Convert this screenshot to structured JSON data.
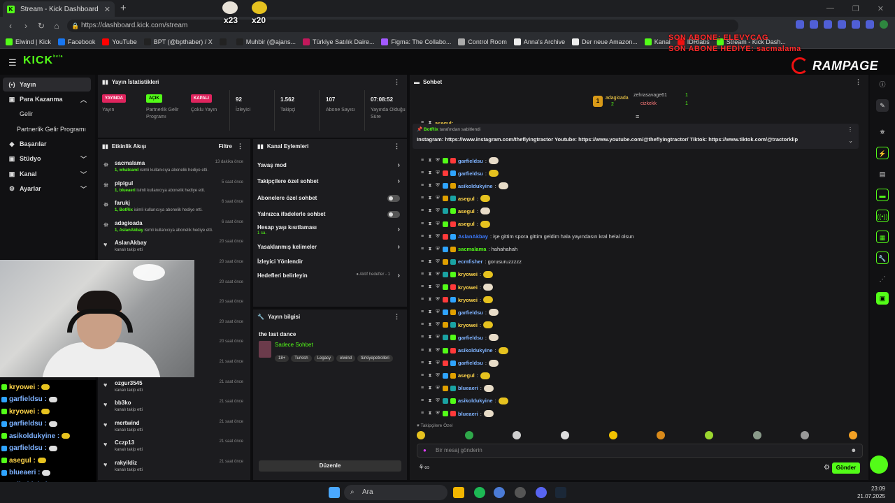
{
  "browser": {
    "tab_title": "Stream - Kick Dashboard",
    "url": "https://dashboard.kick.com/stream",
    "bookmarks": [
      "Elwind | Kick",
      "Facebook",
      "YouTube",
      "BPT (@bpthaber) / X",
      "",
      "Muhbir (@ajans...",
      "Türkiye Satılık Daire...",
      "Figma: The Collabo...",
      "Control Room",
      "Anna's Archive",
      "Der neue Amazon...",
      "Kanal",
      "IDRlabs",
      "Stream - Kick Dash..."
    ]
  },
  "overlay": {
    "last_follower": "SON ABONE: ELEVYCAG",
    "last_gift": "SON ABONE HEDİYE: sacmalama",
    "counter1": "x23",
    "counter2": "x20",
    "brand": "RAMPAGE"
  },
  "sidebar": {
    "items": [
      {
        "icon": "(•)",
        "label": "Yayın"
      },
      {
        "icon": "▣",
        "label": "Para Kazanma"
      },
      {
        "label": "Gelir"
      },
      {
        "label": "Partnerlik Gelir Programı"
      },
      {
        "icon": "◆",
        "label": "Başarılar"
      },
      {
        "icon": "▣",
        "label": "Stüdyo"
      },
      {
        "icon": "▣",
        "label": "Kanal"
      },
      {
        "icon": "⚙",
        "label": "Ayarlar"
      }
    ]
  },
  "stats": {
    "title": "Yayın İstatistikleri",
    "badges": [
      {
        "badge": "YAYINDA",
        "label": "Yayın"
      },
      {
        "badge": "AÇIK",
        "label": "Partnerlik Gelir Programı"
      },
      {
        "badge": "KAPALI",
        "label": "Çoklu Yayın"
      }
    ],
    "numbers": [
      {
        "value": "92",
        "label": "İzleyici"
      },
      {
        "value": "1.562",
        "label": "Takipçi"
      },
      {
        "value": "107",
        "label": "Abone Sayısı"
      },
      {
        "value": "07:08:52",
        "label": "Yayında Olduğu Süre"
      }
    ]
  },
  "activity": {
    "title": "Etkinlik Akışı",
    "filter": "Filtre",
    "items": [
      {
        "name": "sacmalama",
        "time": "13 dakika önce",
        "by": "1, whatcand",
        "rest": " isimli kullanıcıya abonelik hediye etti."
      },
      {
        "name": "pipigul",
        "time": "5 saat önce",
        "by": "1, blueaeri",
        "rest": " isimli kullanıcıya abonelik hediye etti."
      },
      {
        "name": "farukj",
        "time": "6 saat önce",
        "by": "1, BotRix",
        "rest": " isimli kullanıcıya abonelik hediye etti."
      },
      {
        "name": "adagioada",
        "time": "6 saat önce",
        "by": "1, AslanAkbay",
        "rest": " isimli kullanıcıya abonelik hediye etti."
      },
      {
        "name": "AslanAkbay",
        "time": "20 saat önce",
        "by": "",
        "rest": "kanalı takip etti"
      },
      {
        "name": "",
        "time": "20 saat önce",
        "by": "",
        "rest": ""
      },
      {
        "name": "",
        "time": "20 saat önce",
        "by": "",
        "rest": ""
      },
      {
        "name": "",
        "time": "20 saat önce",
        "by": "",
        "rest": ""
      },
      {
        "name": "",
        "time": "20 saat önce",
        "by": "",
        "rest": ""
      },
      {
        "name": "",
        "time": "20 saat önce",
        "by": "",
        "rest": ""
      },
      {
        "name": "",
        "time": "21 saat önce",
        "by": "",
        "rest": ""
      },
      {
        "name": "ozgur3545",
        "time": "21 saat önce",
        "by": "",
        "rest": "kanalı takip etti"
      },
      {
        "name": "bb3ko",
        "time": "21 saat önce",
        "by": "",
        "rest": "kanalı takip etti"
      },
      {
        "name": "mertwind",
        "time": "21 saat önce",
        "by": "",
        "rest": "kanalı takip etti"
      },
      {
        "name": "Cczp13",
        "time": "21 saat önce",
        "by": "",
        "rest": "kanalı takip etti"
      },
      {
        "name": "rakyildiz",
        "time": "21 saat önce",
        "by": "",
        "rest": "kanalı takip etti"
      }
    ]
  },
  "channel_actions": {
    "title": "Kanal Eylemleri",
    "items": [
      {
        "label": "Yavaş mod",
        "ctrl": "chev"
      },
      {
        "label": "Takipçilere özel sohbet",
        "ctrl": "chev"
      },
      {
        "label": "Abonelere özel sohbet",
        "ctrl": "toggle"
      },
      {
        "label": "Yalnızca ifadelerle sohbet",
        "ctrl": "toggle"
      },
      {
        "label": "Hesap yaşı kısıtlaması",
        "sub": "1 sa.",
        "ctrl": "chev"
      },
      {
        "label": "Yasaklanmış kelimeler",
        "ctrl": "chev"
      },
      {
        "label": "İzleyici Yönlendir",
        "ctrl": ""
      },
      {
        "label": "Hedefleri belirleyin",
        "extra": "● Aktif hedefler - 1",
        "ctrl": "chev"
      }
    ]
  },
  "stream_info": {
    "title": "Yayın bilgisi",
    "stream_title": "the last dance",
    "category": "Sadece Sohbet",
    "tags": [
      "18+",
      "Turkish",
      "Legacy",
      "elwind",
      "türkiyepetrolleri"
    ],
    "edit": "Düzenle"
  },
  "chat": {
    "title": "Sohbet",
    "gifters": [
      {
        "rank": "1",
        "name": "adagioada",
        "count": "2"
      },
      {
        "name": "zehrasavage61",
        "count": "1"
      },
      {
        "name": "cizkekk",
        "count": "1"
      }
    ],
    "pinned_by": "BotRix",
    "pinned_by_suffix": " tarafından sabitlendi",
    "pinned_text": "Instagram: https://www.instagram.com/theflyingtractor Youtube: https://www.youtube.com/@theflyingtractor/ Tiktok: https://www.tiktok.com/@tractorklip",
    "top_partial": "asegul:",
    "messages": [
      {
        "user": "garfieldsu",
        "color": "#7fb3ff",
        "text": ""
      },
      {
        "user": "garfieldsu",
        "color": "#7fb3ff",
        "text": ""
      },
      {
        "user": "asikoldukyine",
        "color": "#7fb3ff",
        "text": ""
      },
      {
        "user": "asegul",
        "color": "#ffd54a",
        "text": ""
      },
      {
        "user": "asegul",
        "color": "#ffd54a",
        "text": ""
      },
      {
        "user": "asegul",
        "color": "#ffd54a",
        "text": ""
      },
      {
        "user": "AslanAkbay",
        "color": "#3d7bff",
        "text": ": işe gittim spora gittim geldim hala yayındasın kral helal olsun"
      },
      {
        "user": "sacmalama",
        "color": "#53fc18",
        "text": ": hahahahah"
      },
      {
        "user": "ecmfisher",
        "color": "#7fb3ff",
        "text": ": gorusuruzzzzz"
      },
      {
        "user": "kryowei",
        "color": "#ffd54a",
        "text": ""
      },
      {
        "user": "kryowei",
        "color": "#ffd54a",
        "text": ""
      },
      {
        "user": "kryowei",
        "color": "#ffd54a",
        "text": ""
      },
      {
        "user": "garfieldsu",
        "color": "#7fb3ff",
        "text": ""
      },
      {
        "user": "kryowei",
        "color": "#ffd54a",
        "text": ""
      },
      {
        "user": "garfieldsu",
        "color": "#7fb3ff",
        "text": ""
      },
      {
        "user": "asikoldukyine",
        "color": "#7fb3ff",
        "text": ""
      },
      {
        "user": "garfieldsu",
        "color": "#7fb3ff",
        "text": ""
      },
      {
        "user": "asegul",
        "color": "#ffd54a",
        "text": ""
      },
      {
        "user": "blueaeri",
        "color": "#7fb3ff",
        "text": ""
      },
      {
        "user": "asikoldukyine",
        "color": "#7fb3ff",
        "text": ""
      },
      {
        "user": "blueaeri",
        "color": "#7fb3ff",
        "text": ""
      }
    ],
    "follower_only": "Takipçilere Özel",
    "placeholder": "Bir mesaj gönderin",
    "send": "Gönder"
  },
  "overlay_chat": [
    {
      "user": "kryowei :",
      "color": "#ffd54a"
    },
    {
      "user": "garfieldsu :",
      "color": "#7fb3ff"
    },
    {
      "user": "kryowei :",
      "color": "#ffd54a"
    },
    {
      "user": "garfieldsu :",
      "color": "#7fb3ff"
    },
    {
      "user": "asikoldukyine :",
      "color": "#7fb3ff"
    },
    {
      "user": "garfieldsu :",
      "color": "#7fb3ff"
    },
    {
      "user": "asegul :",
      "color": "#ffd54a"
    },
    {
      "user": "blueaeri :",
      "color": "#7fb3ff"
    },
    {
      "user": "asikoldukyine :",
      "color": "#7fb3ff"
    }
  ],
  "taskbar": {
    "search": "Ara",
    "time": "23:09",
    "date": "21.07.2025"
  },
  "colors": {
    "accent": "#53fc18",
    "live": "#e0245e"
  }
}
